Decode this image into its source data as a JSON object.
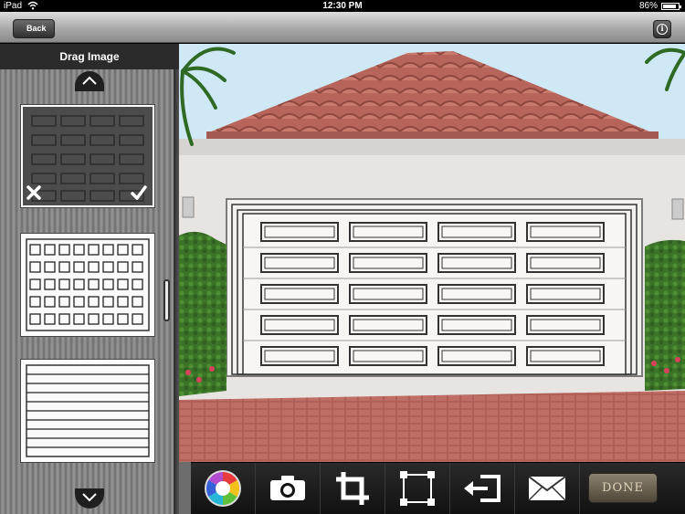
{
  "status_bar": {
    "carrier": "iPad",
    "time": "12:30 PM",
    "battery": "86%"
  },
  "nav": {
    "back_label": "Back",
    "info_icon": "info-icon"
  },
  "sidebar": {
    "title": "Drag Image",
    "scroll_up_icon": "chevron-up-icon",
    "scroll_down_icon": "chevron-down-icon",
    "thumbnails": [
      {
        "style": "long-panel dark",
        "selected": true
      },
      {
        "style": "short-panel white",
        "selected": false
      },
      {
        "style": "flush ribbed white",
        "selected": false
      }
    ],
    "reject_icon": "close-icon",
    "accept_icon": "checkmark-icon"
  },
  "toolbar": {
    "items": [
      {
        "name": "color-wheel-icon"
      },
      {
        "name": "camera-icon"
      },
      {
        "name": "crop-icon"
      },
      {
        "name": "resize-frame-icon"
      },
      {
        "name": "undo-icon"
      },
      {
        "name": "email-icon"
      }
    ],
    "done_label": "DONE"
  },
  "colors": {
    "roof": "#b86a5e",
    "wall": "#e6e2df",
    "brick": "#b5625a",
    "hedge": "#3f7a2a"
  }
}
